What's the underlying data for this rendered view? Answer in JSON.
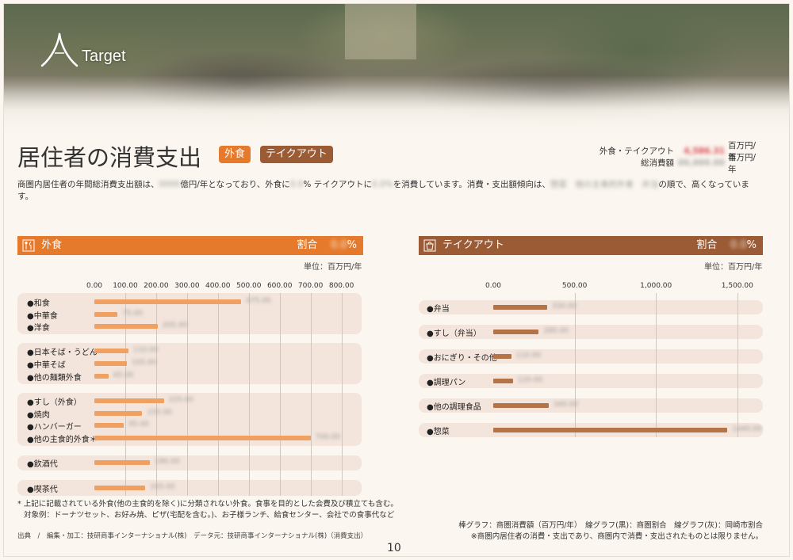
{
  "banner": {
    "logo_text": "Target"
  },
  "title": "居住者の消費支出",
  "tags": {
    "dine_out": "外食",
    "takeout": "テイクアウト"
  },
  "summary": {
    "row1_label": "外食・テイクアウト",
    "row1_value": "4,586.31",
    "row1_unit": "百万円/年",
    "row2_label": "総消費額",
    "row2_value": "00,000.00",
    "row2_unit": "百万円/年"
  },
  "intro": {
    "p1": "商圏内居住者の年間総消費支出額は、",
    "b1": "0000",
    "p2": "億円/年となっており、外食に",
    "b2": "0.0",
    "p3": "% テイクアウトに",
    "b3": "0.0%",
    "p4": "を消費しています。消費・支出額傾向は、",
    "b4": "惣菜　他の主食的外食　弁当",
    "p5": "の順で、高くなっています。"
  },
  "dine_panel": {
    "heading": "外食",
    "share_label": "割合",
    "share_value": "0.0",
    "share_unit": "%",
    "unit_note": "単位：百万円/年"
  },
  "take_panel": {
    "heading": "テイクアウト",
    "share_label": "割合",
    "share_value": "0.0",
    "share_unit": "%",
    "unit_note": "単位：百万円/年"
  },
  "chart_data": [
    {
      "type": "bar",
      "orientation": "horizontal",
      "categories": [
        "●和食",
        "●中華食",
        "●洋食",
        "●日本そば・うどん",
        "●中華そば",
        "●他の麺類外食",
        "●すし（外食）",
        "●焼肉",
        "●ハンバーガー",
        "●他の主食的外食＊",
        "●飲酒代",
        "●喫茶代"
      ],
      "values": [
        475,
        75,
        205,
        110,
        105,
        45,
        225,
        155,
        95,
        700,
        180,
        165
      ],
      "xlim": [
        0,
        800
      ],
      "xticks": [
        "0.00",
        "100.00",
        "200.00",
        "300.00",
        "400.00",
        "500.00",
        "600.00",
        "700.00",
        "800.00"
      ],
      "color": "#f0a061"
    },
    {
      "type": "bar",
      "orientation": "horizontal",
      "categories": [
        "●弁当",
        "●すし（弁当）",
        "●おにぎり・その他",
        "●調理パン",
        "●他の調理食品",
        "●惣菜"
      ],
      "values": [
        330,
        280,
        110,
        120,
        340,
        1440
      ],
      "xlim": [
        0,
        1800
      ],
      "xticks": [
        "0.00",
        "500.00",
        "1,000.00",
        "1,500.00"
      ],
      "color": "#b57447"
    }
  ],
  "footnote": {
    "line1": "* 上記に記載されている外食(他の主食的を除く)に分類されない外食。食事を目的とした会費及び積立ても含む。",
    "line2": "対象例：ドーナツセット、お好み焼、ピザ(宅配を含む。)、お子様ランチ、給食センター、会社での食事代など"
  },
  "legend": {
    "line1": "棒グラフ：商圏消費額（百万円/年）　線グラフ(黒)：商圏割合　線グラフ(灰)：岡崎市割合",
    "line2": "※商圏内居住者の消費・支出であり、商圏内で消費・支出されたものとは限りません。"
  },
  "source": "出典　/　編集・加工：技研商事インターナショナル(株)　データ元：技研商事インターナショナル(株)（消費支出）",
  "page_number": "10"
}
